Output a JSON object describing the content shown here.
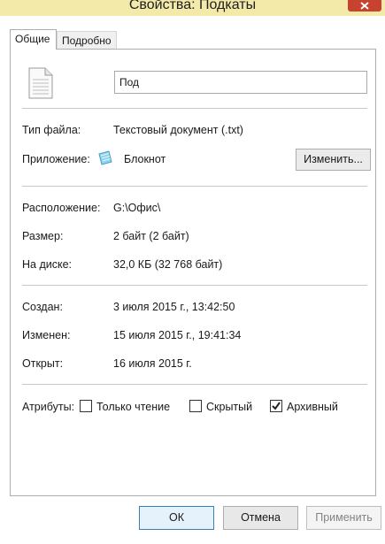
{
  "window": {
    "title": "Свойства: Подкаты"
  },
  "tabs": [
    {
      "label": "Общие"
    },
    {
      "label": "Подробно"
    }
  ],
  "file": {
    "name": "Под"
  },
  "rows": {
    "type_label": "Тип файла:",
    "type_value": "Текстовый документ (.txt)",
    "app_label": "Приложение:",
    "app_value": "Блокнот",
    "change_label": "Изменить...",
    "location_label": "Расположение:",
    "location_value": "G:\\Офис\\",
    "size_label": "Размер:",
    "size_value": "2 байт (2 байт)",
    "disk_label": "На диске:",
    "disk_value": "32,0 КБ (32 768 байт)",
    "created_label": "Создан:",
    "created_value": "3 июля 2015 г., 13:42:50",
    "modified_label": "Изменен:",
    "modified_value": "15 июля 2015 г., 19:41:34",
    "opened_label": "Открыт:",
    "opened_value": "16 июля 2015 г."
  },
  "attributes": {
    "label": "Атрибуты:",
    "readonly": {
      "label": "Только чтение",
      "checked": false
    },
    "hidden": {
      "label": "Скрытый",
      "checked": false
    },
    "archive": {
      "label": "Архивный",
      "checked": true
    }
  },
  "buttons": {
    "ok": "ОК",
    "cancel": "Отмена",
    "apply": "Применить"
  },
  "colors": {
    "titlebar": "#f3e9a9",
    "close": "#c7422f",
    "ok_border": "#3c7fb1"
  }
}
